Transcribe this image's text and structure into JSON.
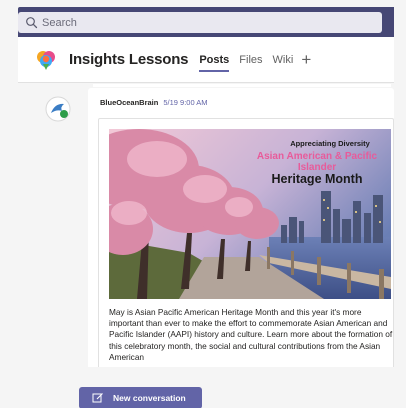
{
  "search": {
    "placeholder": "Search"
  },
  "channel": {
    "team_name": "Insights Lessons",
    "tabs": [
      {
        "label": "Posts",
        "active": true
      },
      {
        "label": "Files",
        "active": false
      },
      {
        "label": "Wiki",
        "active": false
      }
    ],
    "add_tab_icon": "plus-icon"
  },
  "post": {
    "author": "BlueOceanBrain",
    "timestamp": "5/19 9:00 AM",
    "banner": {
      "line1": "Appreciating Diversity",
      "line2": "Asian American & Pacific Islander",
      "line3": "Heritage Month"
    },
    "body": "May is Asian Pacific American Heritage Month and this year it's more important than ever to make the effort to commemorate Asian American and Pacific Islander (AAPI) history and culture. Learn more about the formation of this celebratory month, the social and cultural contributions from the Asian American"
  },
  "compose": {
    "label": "New conversation",
    "icon": "compose-icon"
  },
  "colors": {
    "brand": "#464775",
    "accent": "#6264a7",
    "banner_pink": "#e85b9a"
  }
}
